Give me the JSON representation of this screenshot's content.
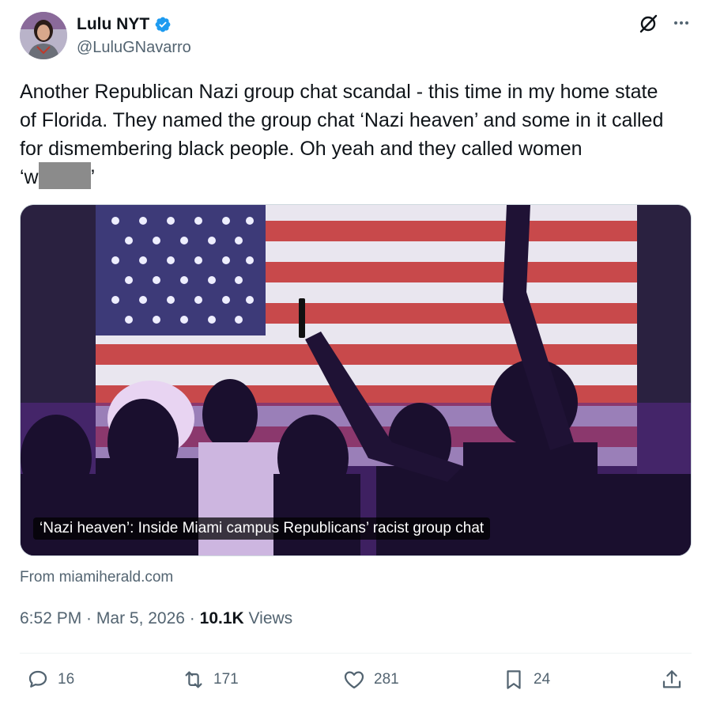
{
  "author": {
    "display_name": "Lulu NYT",
    "handle": "@LuluGNavarro",
    "verified_color": "#1d9bf0"
  },
  "header_icons": {
    "grok": "grok-icon",
    "more": "more-options-icon"
  },
  "tweet": {
    "line1": "Another Republican Nazi group chat scandal - this time in my home state",
    "line2": "of Florida. They named the group chat ‘Nazi heaven’ and some in it called",
    "line3": "for dismembering black people. Oh yeah and they called women",
    "line4_start": "‘w",
    "line4_end": "’"
  },
  "card": {
    "caption": "‘Nazi heaven’: Inside Miami campus Republicans’ racist group chat"
  },
  "source": "From miamiherald.com",
  "meta": {
    "time": "6:52 PM",
    "sep1": " · ",
    "date": "Mar 5, 2026",
    "sep2": " · ",
    "views_count": "10.1K",
    "views_label": " Views"
  },
  "actions": {
    "replies": "16",
    "reposts": "171",
    "likes": "281",
    "bookmarks": "24",
    "icon_color": "#536471"
  }
}
